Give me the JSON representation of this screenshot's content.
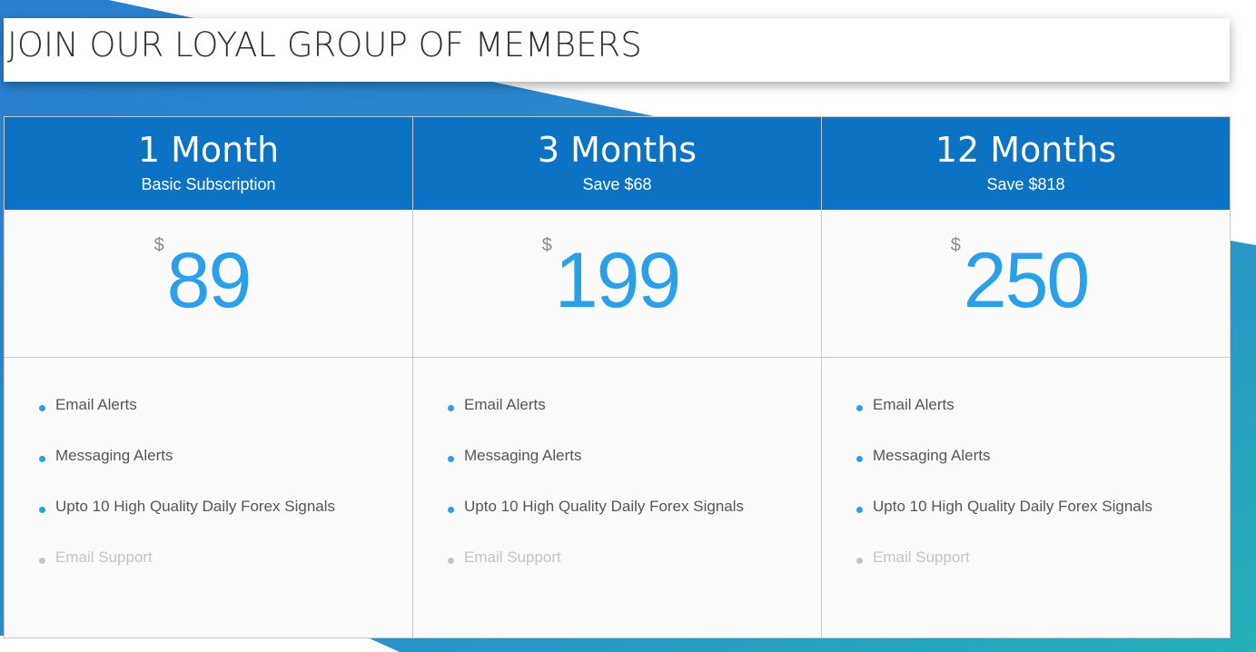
{
  "heading": "JOIN OUR LOYAL GROUP OF MEMBERS",
  "colors": {
    "header_blue": "#0c72c4",
    "price_blue": "#2aa0ea",
    "bg_gradient_start": "#2a7fd0",
    "bg_gradient_end": "#24b0b8",
    "disabled_grey": "#c4c4c4"
  },
  "plans": [
    {
      "title": "1 Month",
      "subtitle": "Basic Subscription",
      "currency": "$",
      "price": "89",
      "features": [
        {
          "label": "Email Alerts",
          "enabled": true
        },
        {
          "label": "Messaging Alerts",
          "enabled": true
        },
        {
          "label": "Upto 10 High Quality Daily Forex Signals",
          "enabled": true
        },
        {
          "label": "Email Support",
          "enabled": false
        }
      ]
    },
    {
      "title": "3 Months",
      "subtitle": "Save $68",
      "currency": "$",
      "price": "199",
      "features": [
        {
          "label": "Email Alerts",
          "enabled": true
        },
        {
          "label": "Messaging Alerts",
          "enabled": true
        },
        {
          "label": "Upto 10 High Quality Daily Forex Signals",
          "enabled": true
        },
        {
          "label": "Email Support",
          "enabled": false
        }
      ]
    },
    {
      "title": "12 Months",
      "subtitle": "Save $818",
      "currency": "$",
      "price": "250",
      "features": [
        {
          "label": "Email Alerts",
          "enabled": true
        },
        {
          "label": "Messaging Alerts",
          "enabled": true
        },
        {
          "label": "Upto 10 High Quality Daily Forex Signals",
          "enabled": true
        },
        {
          "label": "Email Support",
          "enabled": false
        }
      ]
    }
  ]
}
